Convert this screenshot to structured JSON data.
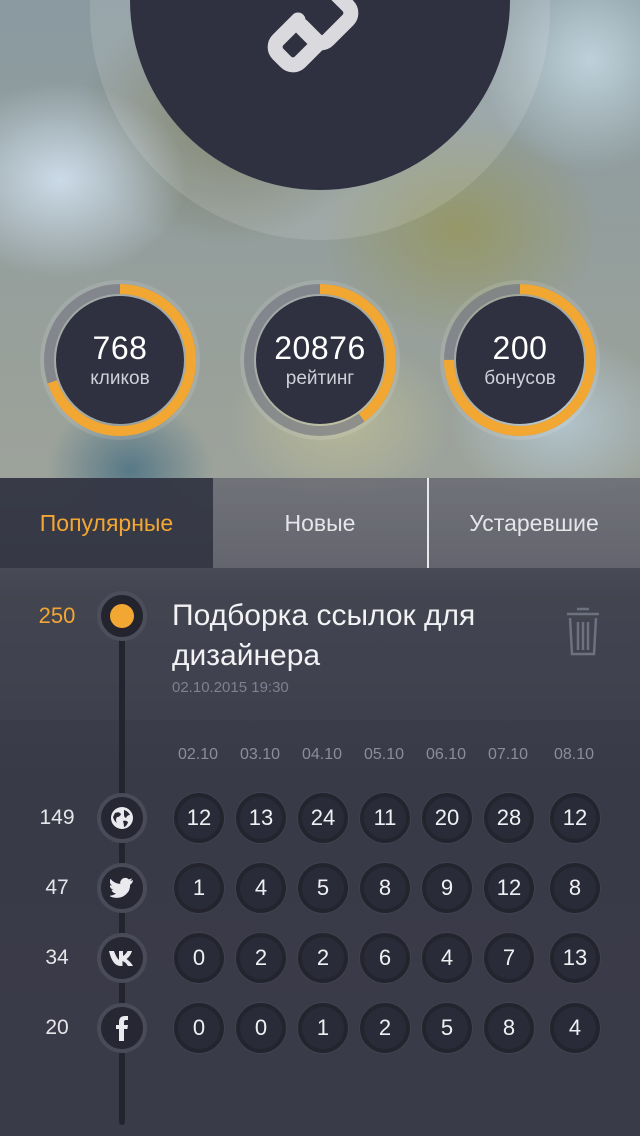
{
  "theme": {
    "accent": "#f3a733",
    "panel": "#2f3040",
    "ring_track": "#4d4e5c"
  },
  "hero": {
    "icon": "link-icon"
  },
  "stats": [
    {
      "value": "768",
      "label": "кликов",
      "progress": 0.7
    },
    {
      "value": "20876",
      "label": "рейтинг",
      "progress": 0.4
    },
    {
      "value": "200",
      "label": "бонусов",
      "progress": 0.75
    }
  ],
  "tabs": [
    {
      "label": "Популярные",
      "active": true
    },
    {
      "label": "Новые",
      "active": false
    },
    {
      "label": "Устаревшие",
      "active": false
    }
  ],
  "item": {
    "count": "250",
    "title": "Подборка ссылок для дизайнера",
    "date": "02.10.2015 19:30",
    "delete_icon": "trash-icon"
  },
  "dates": [
    "02.10",
    "03.10",
    "04.10",
    "05.10",
    "06.10",
    "07.10",
    "08.10"
  ],
  "rows": [
    {
      "source": "web",
      "icon": "globe-icon",
      "total": "149",
      "values": [
        "12",
        "13",
        "24",
        "11",
        "20",
        "28",
        "12"
      ]
    },
    {
      "source": "twitter",
      "icon": "twitter-icon",
      "total": "47",
      "values": [
        "1",
        "4",
        "5",
        "8",
        "9",
        "12",
        "8"
      ]
    },
    {
      "source": "vk",
      "icon": "vk-icon",
      "total": "34",
      "values": [
        "0",
        "2",
        "2",
        "6",
        "4",
        "7",
        "13"
      ]
    },
    {
      "source": "facebook",
      "icon": "facebook-icon",
      "total": "20",
      "values": [
        "0",
        "0",
        "1",
        "2",
        "5",
        "8",
        "4"
      ]
    }
  ]
}
